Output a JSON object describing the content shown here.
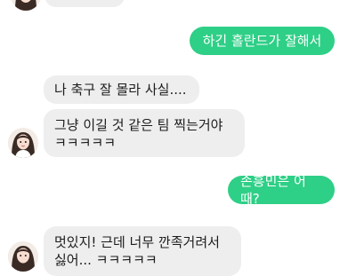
{
  "messages": [
    {
      "from": "other",
      "text": ""
    },
    {
      "from": "me",
      "text": "하긴 홀란드가 잘해서"
    },
    {
      "from": "other",
      "text": "나 축구 잘 몰라 사실...."
    },
    {
      "from": "other",
      "text": "그냥 이길 것 같은 팀 찍는거야\nㅋㅋㅋㅋㅋ"
    },
    {
      "from": "me",
      "text": "손흥민은 어때?"
    },
    {
      "from": "other",
      "text": "멋있지! 근데 너무 깐족거려서\n싫어... ㅋㅋㅋㅋㅋ"
    }
  ],
  "colors": {
    "outgoing_bubble": "#2ecf86",
    "incoming_bubble": "#eeeeee",
    "background": "#ffffff"
  },
  "icons": {
    "avatar": "girl-avatar-icon"
  }
}
